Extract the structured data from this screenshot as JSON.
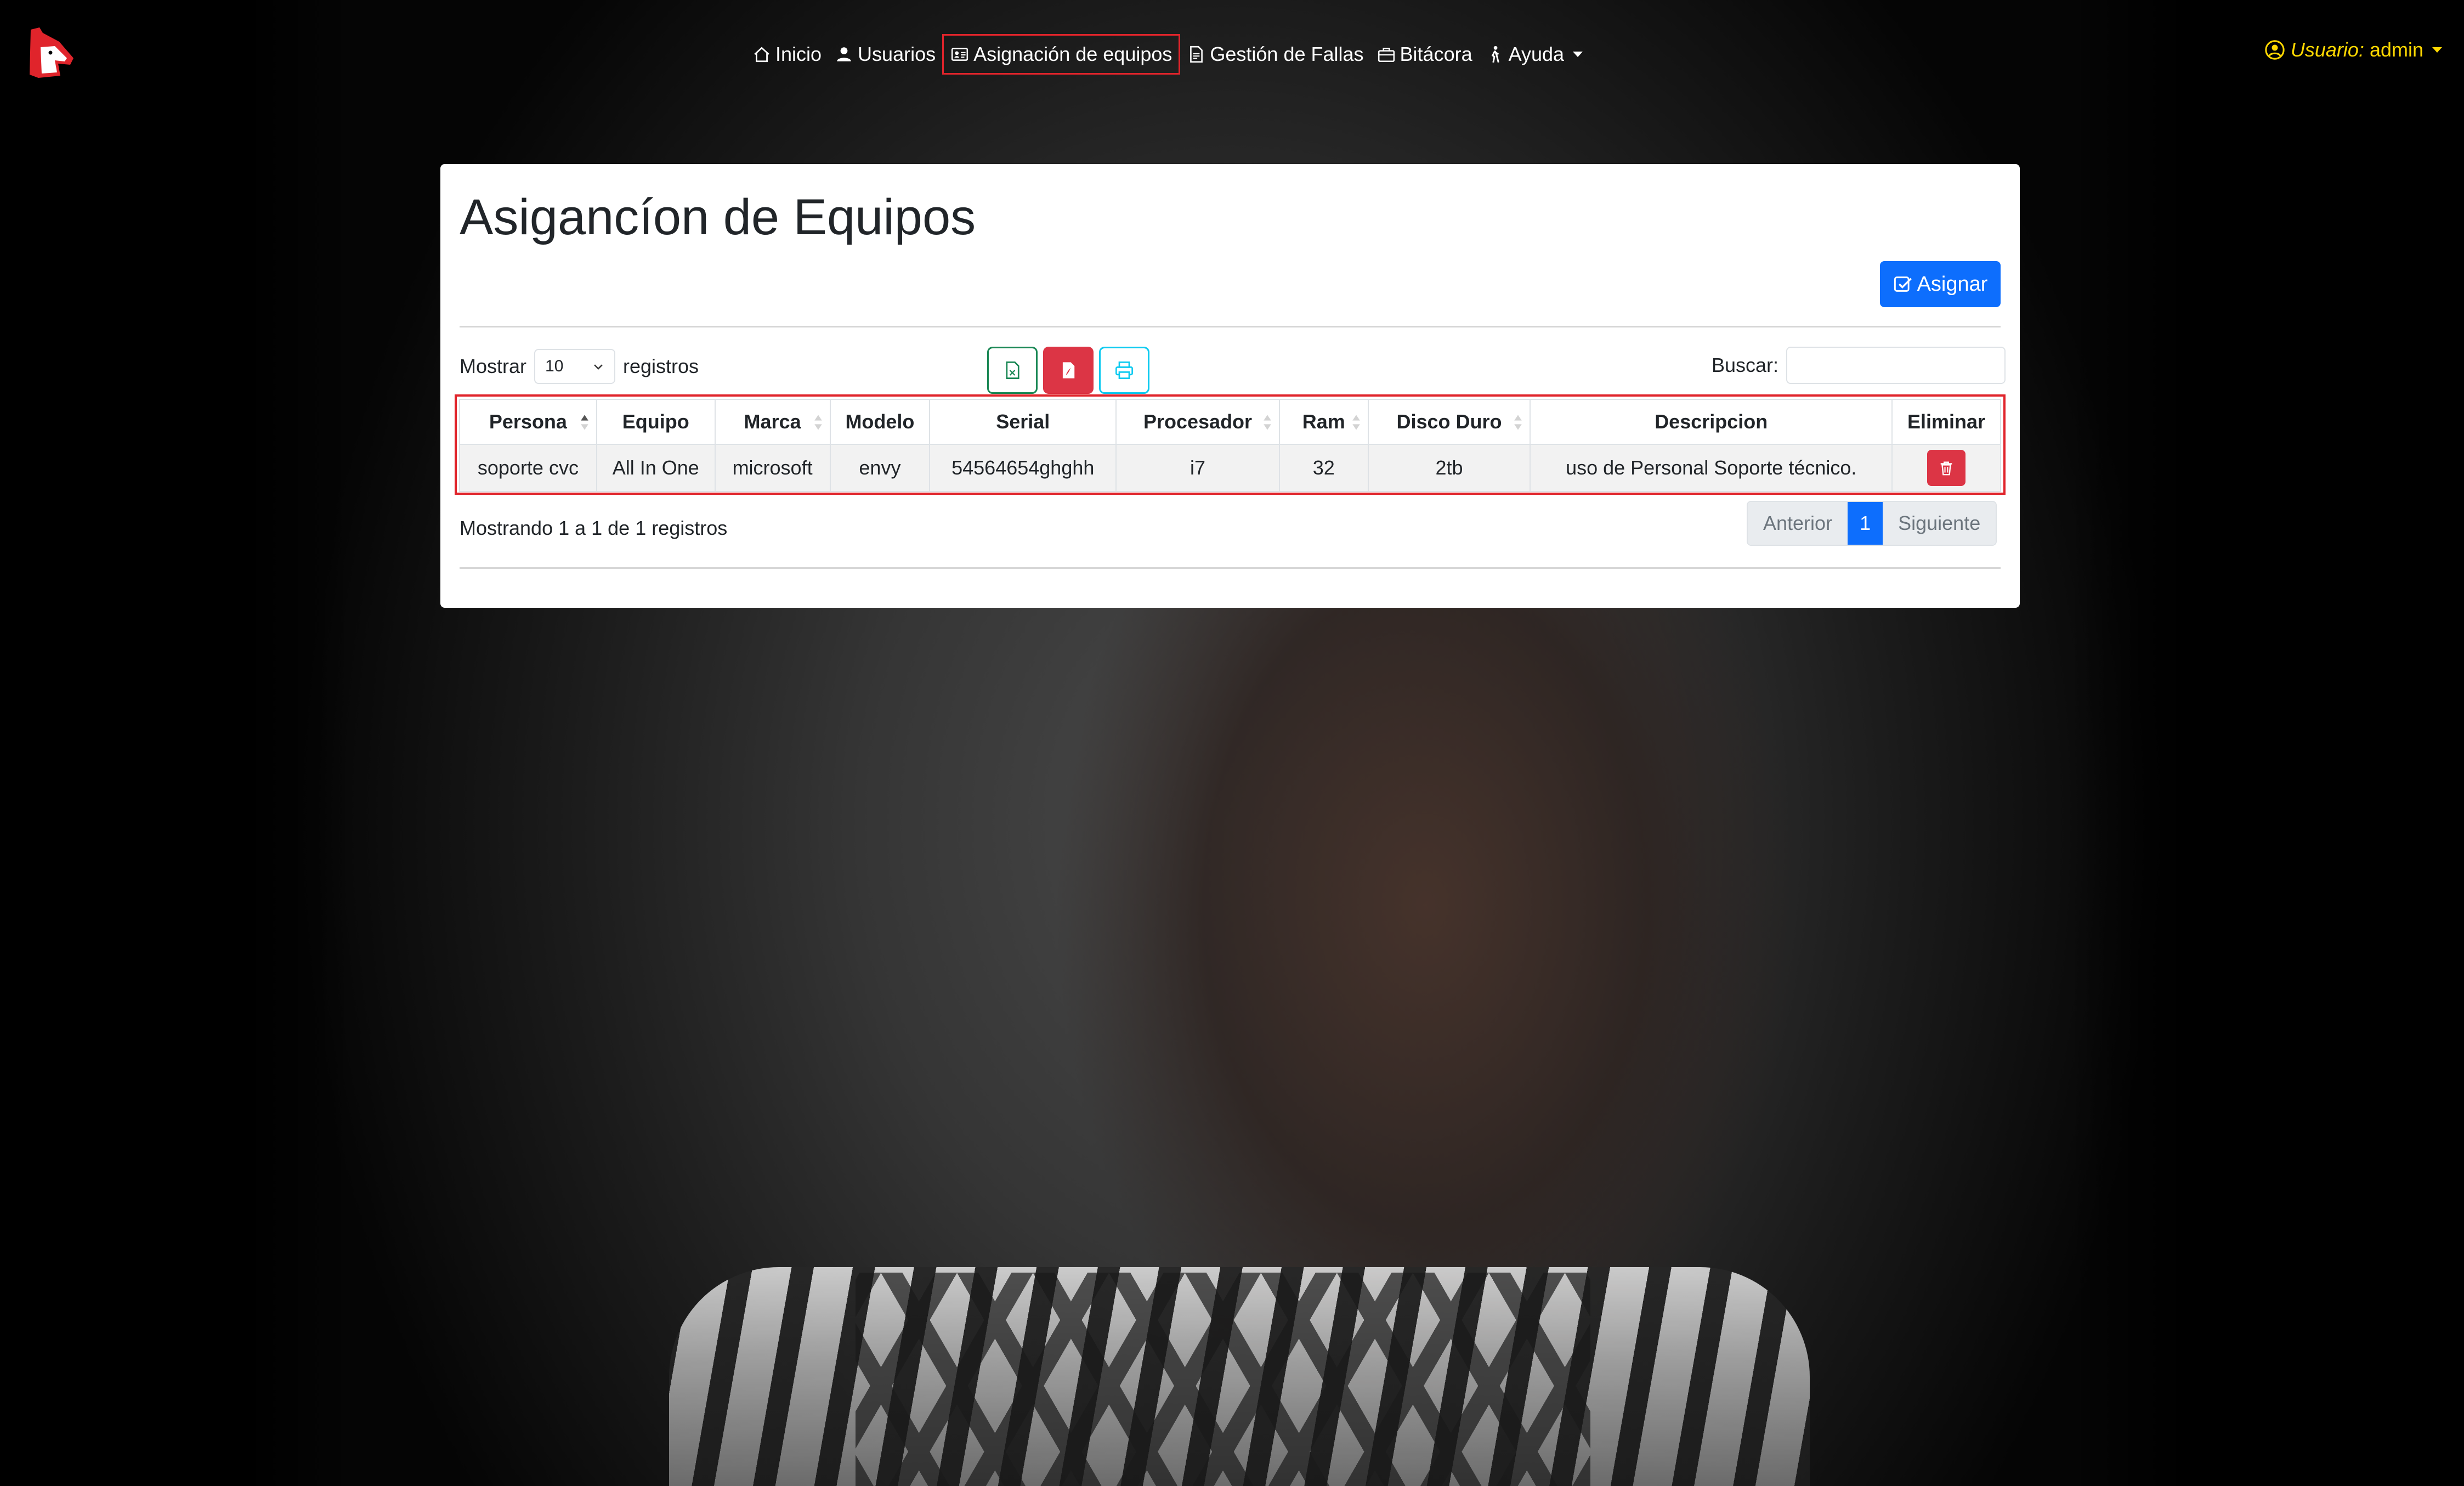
{
  "navbar": {
    "items": [
      {
        "label": "Inicio",
        "icon": "house-icon"
      },
      {
        "label": "Usuarios",
        "icon": "person-icon"
      },
      {
        "label": "Asignación de equipos",
        "icon": "id-card-icon",
        "active": true
      },
      {
        "label": "Gestión de Fallas",
        "icon": "document-icon"
      },
      {
        "label": "Bitácora",
        "icon": "briefcase-icon"
      },
      {
        "label": "Ayuda",
        "icon": "person-walking-icon",
        "dropdown": true
      }
    ],
    "user": {
      "label": "Usuario:",
      "name": "admin",
      "color": "#ffd800"
    },
    "active_border_color": "#e0242b"
  },
  "page": {
    "title": "Asigancíon de Equipos",
    "assign_button": "Asignar"
  },
  "table_controls": {
    "show_label": "Mostrar",
    "page_size": "10",
    "records_label": "registros",
    "search_label": "Buscar:",
    "search_value": "",
    "export_buttons": [
      "excel-icon",
      "pdf-icon",
      "printer-icon"
    ]
  },
  "table": {
    "columns": [
      "Persona",
      "Equipo",
      "Marca",
      "Modelo",
      "Serial",
      "Procesador",
      "Ram",
      "Disco Duro",
      "Descripcion",
      "Eliminar"
    ],
    "rows": [
      {
        "persona": "soporte cvc",
        "equipo": "All In One",
        "marca": "microsoft",
        "modelo": "envy",
        "serial": "54564654ghghh",
        "procesador": "i7",
        "ram": "32",
        "disco": "2tb",
        "descripcion": "uso de Personal Soporte técnico."
      }
    ]
  },
  "footer": {
    "info": "Mostrando 1 a 1 de 1 registros",
    "prev": "Anterior",
    "current_page": "1",
    "next": "Siguiente"
  },
  "colors": {
    "primary": "#0d6efd",
    "danger": "#dc3545",
    "success": "#198754",
    "info": "#0dcaf0"
  }
}
